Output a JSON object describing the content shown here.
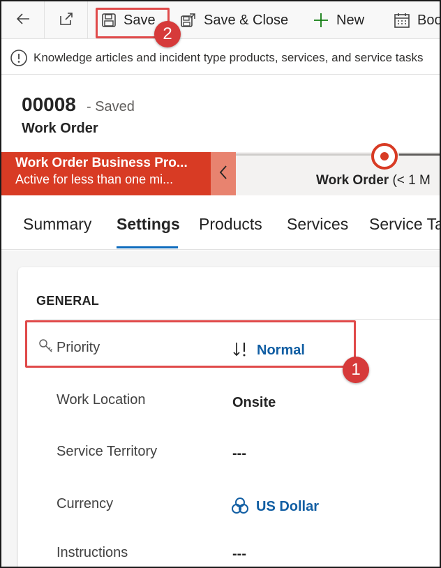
{
  "command_bar": {
    "back_icon": "back-arrow-icon",
    "popout_icon": "open-in-new-window-icon",
    "save_label": "Save",
    "save_close_label": "Save & Close",
    "new_label": "New",
    "book_label": "Boo"
  },
  "notification": {
    "icon": "info-icon",
    "text": "Knowledge articles and incident type products, services, and service tasks"
  },
  "header": {
    "record_number": "00008",
    "save_status": "- Saved",
    "entity_name": "Work Order"
  },
  "bpf": {
    "title": "Work Order Business Pro...",
    "subtitle": "Active for less than one mi...",
    "stage_name": "Work Order",
    "stage_time": "(< 1 M"
  },
  "tabs": [
    {
      "label": "Summary",
      "active": false
    },
    {
      "label": "Settings",
      "active": true
    },
    {
      "label": "Products",
      "active": false
    },
    {
      "label": "Services",
      "active": false
    },
    {
      "label": "Service Ta",
      "active": false
    }
  ],
  "section": {
    "title": "GENERAL",
    "fields": [
      {
        "label": "Priority",
        "value": "Normal",
        "icon": "key-icon",
        "value_icon": "sort-priority-icon"
      },
      {
        "label": "Work Location",
        "value": "Onsite"
      },
      {
        "label": "Service Territory",
        "value": "---"
      },
      {
        "label": "Currency",
        "value": "US Dollar",
        "value_icon": "currency-icon"
      },
      {
        "label": "Instructions",
        "value": "---"
      }
    ]
  },
  "annotations": {
    "callout_1": "1",
    "callout_2": "2"
  },
  "colors": {
    "bpf_active": "#d83b24",
    "link": "#115ea3",
    "tab_underline": "#0f6cbd",
    "annotation": "#e04a4a"
  }
}
